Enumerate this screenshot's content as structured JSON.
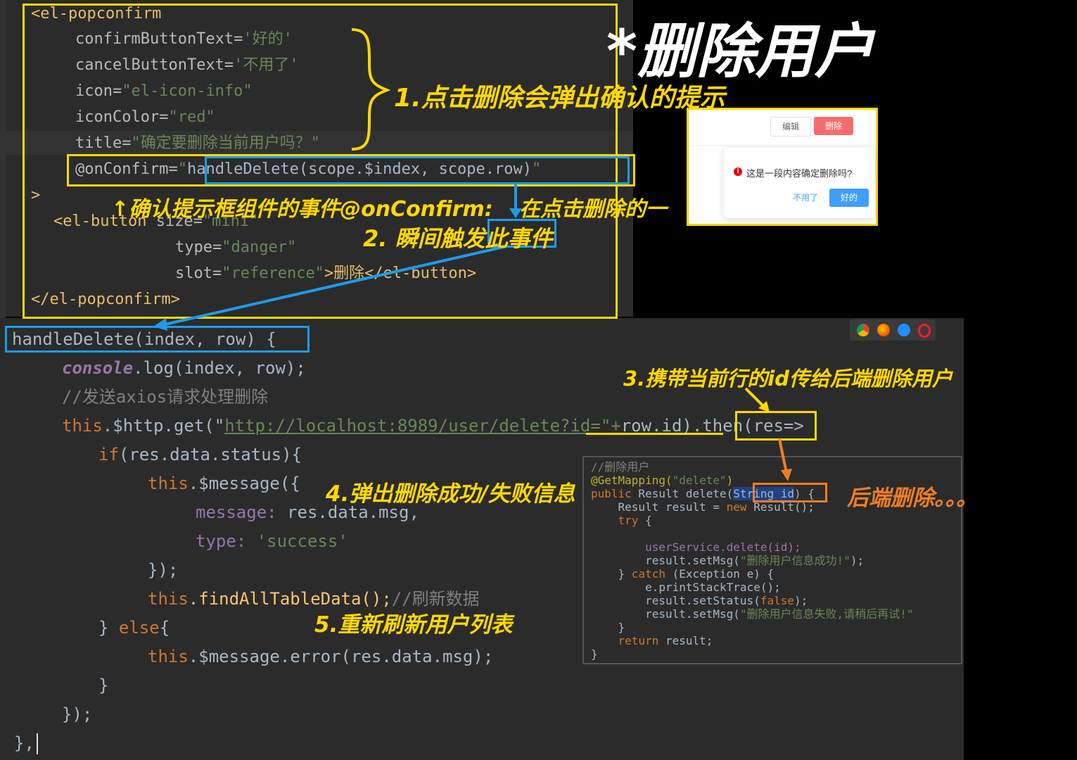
{
  "title": "*删除用户",
  "vue_code": {
    "line1": "<el-popconfirm",
    "line2_attr": "confirmButtonText=",
    "line2_val": "'好的'",
    "line3_attr": "cancelButtonText=",
    "line3_val": "'不用了'",
    "line4_attr": "icon=",
    "line4_val": "\"el-icon-info\"",
    "line5_attr": "iconColor=",
    "line5_val": "\"red\"",
    "line6_attr": "title=",
    "line6_val": "\"确定要删除当前用户吗？\"",
    "line7_attr": "@onConfirm=",
    "line7_q": "\"",
    "line7_handler": "handleDelete(scope.$index, scope.row)",
    "line7_q2": "\"",
    "line8": ">",
    "line9_tag": "<el-button",
    "line9_attr": " size=",
    "line9_val": "\"mini\"",
    "line10_attr": "type=",
    "line10_val": "\"danger\"",
    "line11_attr": "slot=",
    "line11_val": "\"reference\"",
    "line11_tag": ">删除</el-button>",
    "line12": "</el-popconfirm>"
  },
  "js_code": {
    "l1_fn": "handleDelete(index, row)",
    "l1_rest": " {",
    "l2_console": "console",
    "l2_rest": ".log(index, row);",
    "l3": "//发送axios请求处理删除",
    "l4_this": "this",
    "l4_a": ".$http.get(\"",
    "l4_url": "http://localhost:8989/user/delete?id=",
    "l4_b": "\"+",
    "l4_row": "row.id",
    "l4_c": ").then(res=>",
    "l5_if": "if",
    "l5_rest": "(res.data.status){",
    "l6_this": "this",
    "l6_rest": ".$message({",
    "l7_key": "message: ",
    "l7_val": "res.data.msg,",
    "l8_key": "type: ",
    "l8_val": "'success'",
    "l9": "});",
    "l10_this": "this",
    "l10_fn": ".findAllTableData();",
    "l10_com": "//刷新数据",
    "l11_a": "} ",
    "l11_else": "else",
    "l11_b": "{",
    "l12_this": "this",
    "l12_rest": ".$message.error(res.data.msg);",
    "l13": "}",
    "l14": "});",
    "l15": "},"
  },
  "annotations": {
    "a1": "1.点击删除会弹出确认的提示",
    "a_confirm": "↑确认提示框组件的事件@onConfirm:",
    "a_confirm_b": "在点击删除的一",
    "a2": "2. 瞬间触发此事件",
    "a3": "3.携带当前行的id传给后端删除用户",
    "a4": "4.弹出删除成功/失败信息",
    "a5": "5.重新刷新用户列表",
    "a_backend": "后端删除。。。"
  },
  "popup": {
    "edit_button": "编辑",
    "delete_button": "删除",
    "message": "这是一段内容确定删除吗?",
    "cancel_button": "不用了",
    "confirm_button": "好的"
  },
  "java_code": {
    "j1": "//删除用户",
    "j2_ann": "@GetMapping(",
    "j2_str": "\"delete\"",
    "j2_end": ")",
    "j3_kw": "public",
    "j3_a": " Result delete(",
    "j3_param": "String id",
    "j3_b": ") {",
    "j4_a": "    Result result = ",
    "j4_kw": "new",
    "j4_b": " Result();",
    "j5_kw": "    try",
    "j5_b": " {",
    "j6_a": "        userService.delete(id);",
    "j7_a": "        result.setMsg(",
    "j7_str": "\"删除用户信息成功!\"",
    "j7_b": ");",
    "j8_a": "    } ",
    "j8_kw": "catch",
    "j8_b": " (Exception e) {",
    "j9_a": "        e.printStackTrace();",
    "j10_a": "        result.setStatus(",
    "j10_kw": "false",
    "j10_b": ");",
    "j11_a": "        result.setMsg(",
    "j11_str": "\"删除用户信息失败,请稍后再试!\"",
    "j12_a": "    }",
    "j13_kw": "    return",
    "j13_b": " result;",
    "j14_a": "}"
  },
  "colors": {
    "yellow_box": "#ffd800",
    "blue_box": "#1e9be9",
    "orange_box": "#f07d24",
    "annotation_yellow": "#ffd800",
    "annotation_orange": "#f07d24",
    "danger_button": "#f56c6c",
    "primary_button": "#409eff"
  },
  "browser_icons": [
    "chrome-icon",
    "firefox-icon",
    "safari-icon",
    "opera-icon"
  ]
}
